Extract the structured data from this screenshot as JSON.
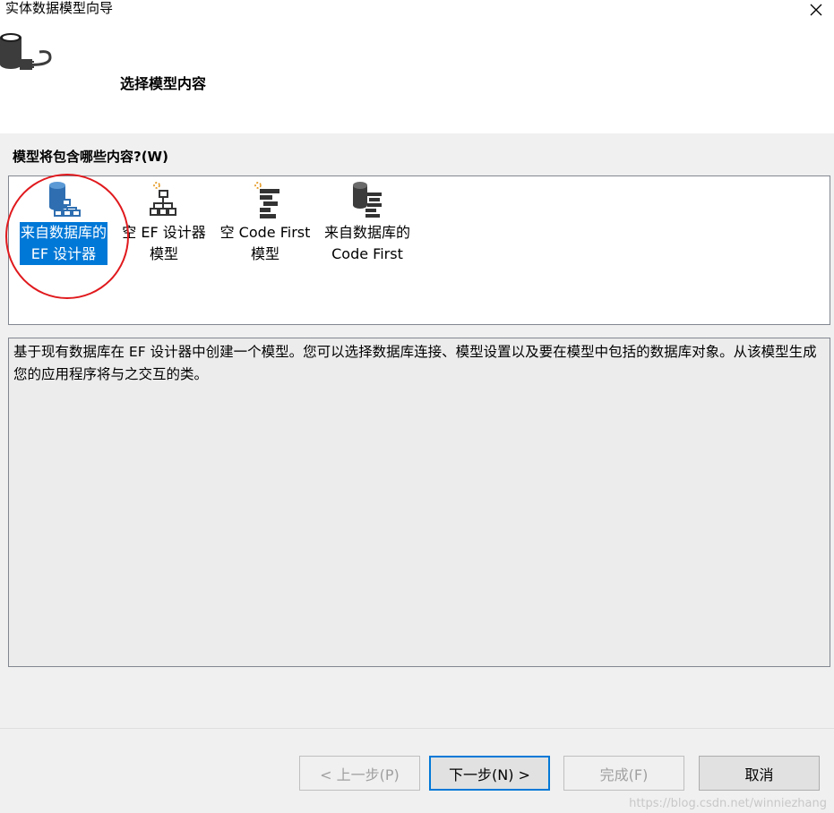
{
  "window": {
    "title": "实体数据模型向导"
  },
  "header": {
    "step_title": "选择模型内容"
  },
  "question": "模型将包含哪些内容?(W)",
  "options": [
    {
      "label": "来自数据库的\nEF 设计器",
      "icon": "database-diagram-icon",
      "selected": true
    },
    {
      "label": "空 EF 设计器\n模型",
      "icon": "empty-diagram-icon",
      "selected": false
    },
    {
      "label": "空 Code First\n模型",
      "icon": "empty-codefirst-icon",
      "selected": false
    },
    {
      "label": "来自数据库的\nCode First",
      "icon": "database-codefirst-icon",
      "selected": false
    }
  ],
  "description": "基于现有数据库在 EF 设计器中创建一个模型。您可以选择数据库连接、模型设置以及要在模型中包括的数据库对象。从该模型生成您的应用程序将与之交互的类。",
  "buttons": {
    "back": "< 上一步(P)",
    "next": "下一步(N) >",
    "finish": "完成(F)",
    "cancel": "取消"
  },
  "watermark": "https://blog.csdn.net/winniezhang",
  "colors": {
    "selection": "#0078d7",
    "annotation_ring": "#e0191d",
    "panel_bg": "#f0f0f0"
  }
}
